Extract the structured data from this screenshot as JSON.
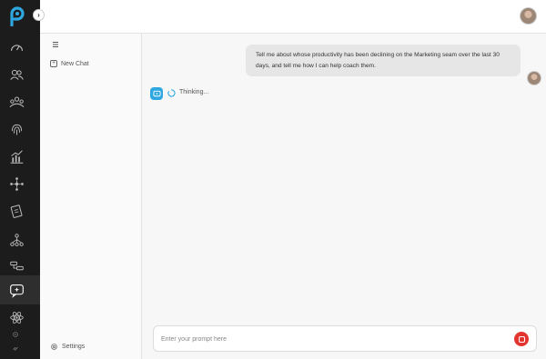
{
  "rail": {
    "logo": "app-logo",
    "toggle_glyph": "›",
    "items": [
      {
        "icon": "dashboard-gauge-icon"
      },
      {
        "icon": "users-icon"
      },
      {
        "icon": "teams-icon"
      },
      {
        "icon": "fingerprint-icon"
      },
      {
        "icon": "analytics-chart-icon"
      },
      {
        "icon": "network-icon"
      },
      {
        "icon": "reports-icon"
      },
      {
        "icon": "hierarchy-icon"
      },
      {
        "icon": "workflow-icon"
      },
      {
        "icon": "ai-chat-icon",
        "active": true
      },
      {
        "icon": "atom-icon"
      }
    ]
  },
  "sidebar": {
    "menu_icon": "hamburger-icon",
    "new_chat_label": "New Chat",
    "settings_label": "Settings"
  },
  "chat": {
    "user_message": "Tell me about whose productivity has been declining on the Marketing seam over the last 30 days, and tell me how I can help coach them.",
    "status_text": "Thinking...",
    "accent_color": "#2ea7e0"
  },
  "prompt": {
    "placeholder": "Enter your prompt here",
    "stop_color": "#e3352f"
  }
}
